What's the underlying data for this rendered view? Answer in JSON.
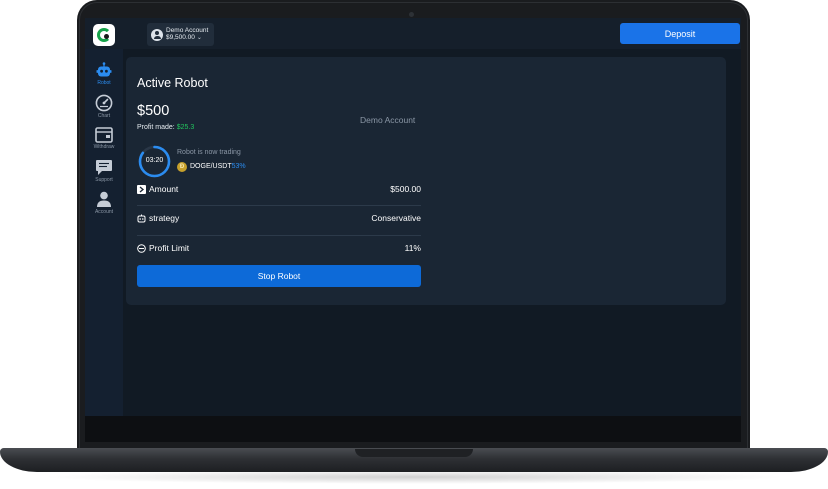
{
  "account": {
    "name": "Demo Account",
    "balance": "$9,500.00"
  },
  "header": {
    "deposit_label": "Deposit"
  },
  "sidebar": {
    "items": [
      {
        "label": "Robot",
        "icon": "robot-icon",
        "active": true
      },
      {
        "label": "Chart",
        "icon": "gauge-icon",
        "active": false
      },
      {
        "label": "Withdraw",
        "icon": "wallet-icon",
        "active": false
      },
      {
        "label": "Support",
        "icon": "chat-icon",
        "active": false
      },
      {
        "label": "Account",
        "icon": "user-icon",
        "active": false
      }
    ]
  },
  "robot": {
    "title": "Active Robot",
    "amount": "$500",
    "profit_label": "Profit made:",
    "profit_value": "$25.3",
    "account_type": "Demo Account",
    "timer": "03:20",
    "timer_progress": 0.85,
    "status": "Robot is now trading",
    "pair": "DOGE/USDT",
    "pair_percent": "53%",
    "rows": [
      {
        "label": "Amount",
        "value": "$500.00",
        "icon": "arrow-icon"
      },
      {
        "label": "strategy",
        "value": "Conservative",
        "icon": "robot-icon"
      },
      {
        "label": "Profit Limit",
        "value": "11%",
        "icon": "limit-icon"
      }
    ],
    "stop_label": "Stop Robot"
  },
  "colors": {
    "accent": "#1a73e8",
    "profit": "#22c55e",
    "background": "#111a24",
    "card": "#1a2634"
  }
}
